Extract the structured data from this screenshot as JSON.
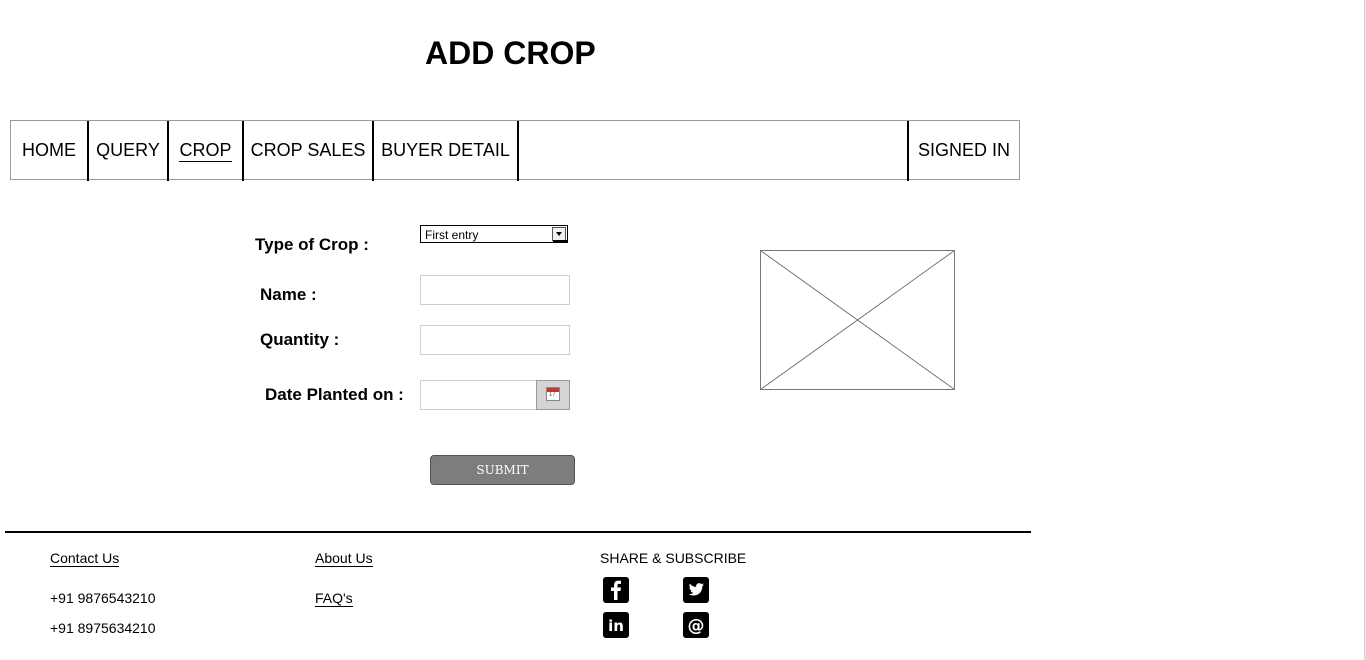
{
  "page": {
    "title": "ADD CROP"
  },
  "nav": {
    "items": [
      {
        "label": "HOME"
      },
      {
        "label": "QUERY"
      },
      {
        "label": "CROP",
        "active": true
      },
      {
        "label": "CROP SALES"
      },
      {
        "label": "BUYER DETAIL"
      }
    ],
    "signed_in": "SIGNED IN"
  },
  "form": {
    "type_of_crop_label": "Type of Crop :",
    "type_of_crop_value": "First entry",
    "name_label": "Name :",
    "name_value": "",
    "quantity_label": "Quantity :",
    "quantity_value": "",
    "date_label": "Date Planted on :",
    "date_value": "",
    "submit_label": "SUBMIT"
  },
  "footer": {
    "contact_us": "Contact Us",
    "phone_1": "+91 9876543210",
    "phone_2": "+91 8975634210",
    "about_us": "About Us",
    "faqs": "FAQ's",
    "share_heading": "SHARE & SUBSCRIBE",
    "social_icons": [
      "facebook-icon",
      "twitter-icon",
      "linkedin-icon",
      "email-icon"
    ]
  },
  "colors": {
    "submit_bg": "#7d7d7d",
    "nav_border": "#9a9a9a",
    "calendar_accent": "#c0392b"
  }
}
